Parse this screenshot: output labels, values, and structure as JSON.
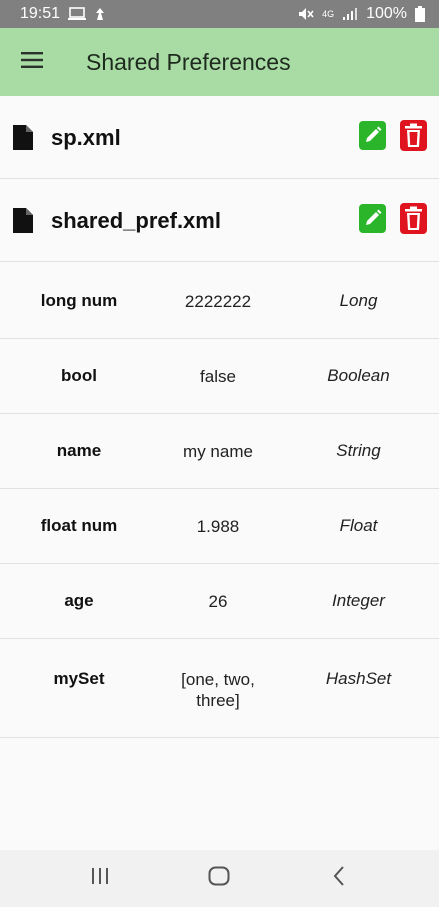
{
  "status_bar": {
    "time": "19:51",
    "battery": "100%",
    "network": "4G"
  },
  "app_bar": {
    "title": "Shared Preferences"
  },
  "files": [
    {
      "name": "sp.xml"
    },
    {
      "name": "shared_pref.xml"
    }
  ],
  "preferences": [
    {
      "key": "long num",
      "value": "2222222",
      "type": "Long"
    },
    {
      "key": "bool",
      "value": "false",
      "type": "Boolean"
    },
    {
      "key": "name",
      "value": "my name",
      "type": "String"
    },
    {
      "key": "float num",
      "value": "1.988",
      "type": "Float"
    },
    {
      "key": "age",
      "value": "26",
      "type": "Integer"
    },
    {
      "key": "mySet",
      "value": "[one, two, three]",
      "type": "HashSet"
    }
  ],
  "colors": {
    "app_bar": "#a8dca4",
    "edit_button": "#2bb52b",
    "delete_button": "#e0141e",
    "status_bar": "#808080"
  },
  "icons": {
    "menu": "hamburger-menu-icon",
    "file": "file-icon",
    "edit": "edit-icon",
    "delete": "trash-icon",
    "recents": "recents-icon",
    "home": "home-icon",
    "back": "back-icon"
  }
}
